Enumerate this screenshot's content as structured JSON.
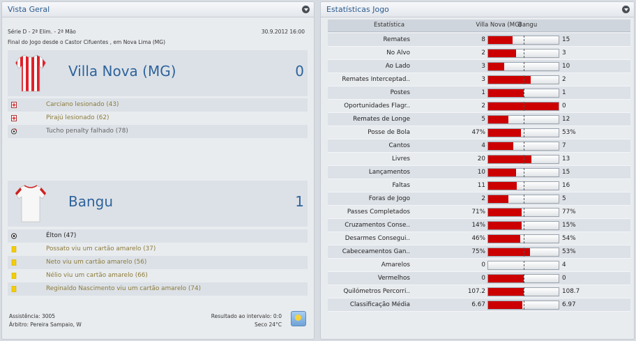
{
  "left_panel": {
    "title": "Vista Geral",
    "competition": "Série D - 2ª Elim. - 2ª Mão",
    "date": "30.9.2012 16:00",
    "result_line": "Final do Jogo desde o Castor Cifuentes , em Nova Lima (MG)",
    "home": {
      "name": "Villa Nova (MG)",
      "score": "0",
      "shirt_colors": [
        "#e0202a",
        "#ffffff"
      ],
      "events": [
        {
          "icon": "injury-icon",
          "text": "Carciano lesionado (43)"
        },
        {
          "icon": "injury-icon",
          "text": "Pirajú lesionado (62)"
        },
        {
          "icon": "penalty-miss-icon",
          "text": "Tucho penalty falhado (78)"
        }
      ]
    },
    "away": {
      "name": "Bangu",
      "score": "1",
      "shirt_colors": [
        "#ffffff",
        "#d02020"
      ],
      "events": [
        {
          "icon": "goal-icon",
          "text": "Élton (47)"
        },
        {
          "icon": "yellow-card-icon",
          "text": "Possato viu um cartão amarelo (37)"
        },
        {
          "icon": "yellow-card-icon",
          "text": "Neto viu um cartão amarelo (56)"
        },
        {
          "icon": "yellow-card-icon",
          "text": "Nélio viu um cartão amarelo (66)"
        },
        {
          "icon": "yellow-card-icon",
          "text": "Reginaldo Nascimento viu um cartão amarelo (74)"
        }
      ]
    },
    "footer": {
      "attendance": "Assistência: 3005",
      "referee": "Árbitro: Pereira Sampaio, W",
      "halftime": "Resultado ao intervalo: 0:0",
      "weather": "Seco 24°C",
      "weather_icon": "sunny-weather-icon"
    }
  },
  "right_panel": {
    "title": "Estatísticas Jogo",
    "columns": {
      "stat": "Estatística",
      "home": "Villa Nova (MG)",
      "away": "Bangu"
    },
    "bar_color": "#cc0000",
    "stats": [
      {
        "label": "Remates",
        "home": "8",
        "away": "15",
        "home_share": 0.35
      },
      {
        "label": "No Alvo",
        "home": "2",
        "away": "3",
        "home_share": 0.4
      },
      {
        "label": "Ao Lado",
        "home": "3",
        "away": "10",
        "home_share": 0.23
      },
      {
        "label": "Remates Interceptad..",
        "home": "3",
        "away": "2",
        "home_share": 0.6
      },
      {
        "label": "Postes",
        "home": "1",
        "away": "1",
        "home_share": 0.5
      },
      {
        "label": "Oportunidades Flagr..",
        "home": "2",
        "away": "0",
        "home_share": 1.0
      },
      {
        "label": "Remates de Longe",
        "home": "5",
        "away": "12",
        "home_share": 0.29
      },
      {
        "label": "Posse de Bola",
        "home": "47%",
        "away": "53%",
        "home_share": 0.47
      },
      {
        "label": "Cantos",
        "home": "4",
        "away": "7",
        "home_share": 0.36
      },
      {
        "label": "Livres",
        "home": "20",
        "away": "13",
        "home_share": 0.61
      },
      {
        "label": "Lançamentos",
        "home": "10",
        "away": "15",
        "home_share": 0.4
      },
      {
        "label": "Faltas",
        "home": "11",
        "away": "16",
        "home_share": 0.41
      },
      {
        "label": "Foras de Jogo",
        "home": "2",
        "away": "5",
        "home_share": 0.29
      },
      {
        "label": "Passes Completados",
        "home": "71%",
        "away": "77%",
        "home_share": 0.48
      },
      {
        "label": "Cruzamentos Conse..",
        "home": "14%",
        "away": "15%",
        "home_share": 0.48
      },
      {
        "label": "Desarmes Consegui..",
        "home": "46%",
        "away": "54%",
        "home_share": 0.46
      },
      {
        "label": "Cabeceamentos Gan..",
        "home": "75%",
        "away": "53%",
        "home_share": 0.59
      },
      {
        "label": "Amarelos",
        "home": "0",
        "away": "4",
        "home_share": 0.0
      },
      {
        "label": "Vermelhos",
        "home": "0",
        "away": "0",
        "home_share": 0.5
      },
      {
        "label": "Quilómetros Percorri..",
        "home": "107.2",
        "away": "108.7",
        "home_share": 0.5
      },
      {
        "label": "Classificação Média",
        "home": "6.67",
        "away": "6.97",
        "home_share": 0.49
      }
    ]
  }
}
